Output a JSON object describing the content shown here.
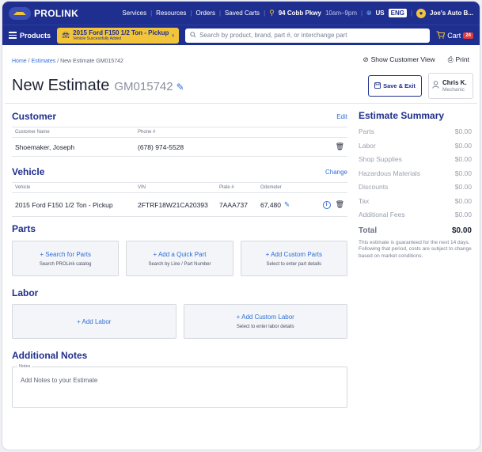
{
  "brand": {
    "name": "PROLINK"
  },
  "topnav": {
    "links": [
      "Services",
      "Resources",
      "Orders",
      "Saved Carts"
    ],
    "store_address": "94 Cobb Pkwy",
    "store_hours": "10am–9pm",
    "country": "US",
    "language": "ENG",
    "account": "Joe's Auto B..."
  },
  "subbar": {
    "products_label": "Products",
    "vehicle_name": "2015 Ford F150 1/2 Ton - Pickup",
    "vehicle_status": "Vehicle Successfully Added",
    "search_placeholder": "Search by product, brand, part #, or interchange part",
    "cart_label": "Cart",
    "cart_count": "24"
  },
  "breadcrumb": {
    "home": "Home",
    "estimates": "Estimates",
    "current": "New Estimate GM015742"
  },
  "actions": {
    "show_customer_view": "Show Customer View",
    "print": "Print",
    "save_exit": "Save & Exit"
  },
  "page": {
    "title": "New Estimate",
    "estimate_number": "GM015742"
  },
  "user": {
    "name": "Chris K.",
    "role": "Mechanic"
  },
  "customer": {
    "title": "Customer",
    "edit_label": "Edit",
    "headers": [
      "Customer Name",
      "Phone #"
    ],
    "name": "Shoemaker, Joseph",
    "phone": "(678) 974-5528"
  },
  "vehicle": {
    "title": "Vehicle",
    "change_label": "Change",
    "headers": [
      "Vehicle",
      "VIN",
      "Plate #",
      "Odometer"
    ],
    "name": "2015 Ford F150 1/2 Ton - Pickup",
    "vin": "2FTRF18W21CA20393",
    "plate": "7AAA737",
    "odometer": "67,480"
  },
  "parts": {
    "title": "Parts",
    "cards": [
      {
        "label": "+ Search for Parts",
        "sub": "Search PROLink catalog"
      },
      {
        "label": "+ Add a Quick Part",
        "sub": "Search by Line / Part Number"
      },
      {
        "label": "+ Add Custom Parts",
        "sub": "Select to enter part details"
      }
    ]
  },
  "labor": {
    "title": "Labor",
    "cards": [
      {
        "label": "+ Add Labor",
        "sub": ""
      },
      {
        "label": "+ Add Custom Labor",
        "sub": "Select to enter labor details"
      }
    ]
  },
  "notes": {
    "title": "Additional Notes",
    "label": "Notes",
    "placeholder": "Add Notes to your Estimate"
  },
  "summary": {
    "title": "Estimate Summary",
    "rows": [
      {
        "label": "Parts",
        "value": "$0.00"
      },
      {
        "label": "Labor",
        "value": "$0.00"
      },
      {
        "label": "Shop Supplies",
        "value": "$0.00"
      },
      {
        "label": "Hazardous Materials",
        "value": "$0.00"
      },
      {
        "label": "Discounts",
        "value": "$0.00"
      },
      {
        "label": "Tax",
        "value": "$0.00"
      },
      {
        "label": "Additional Fees",
        "value": "$0.00"
      }
    ],
    "total_label": "Total",
    "total_value": "$0.00",
    "note": "This estimate is guaranteed for the next 14 days. Following that period, costs are subject to change based on market conditions."
  },
  "colors": {
    "primary": "#1f2f8f",
    "accent": "#f2c43a",
    "link": "#2f6fd6",
    "badge": "#e23b3b"
  }
}
